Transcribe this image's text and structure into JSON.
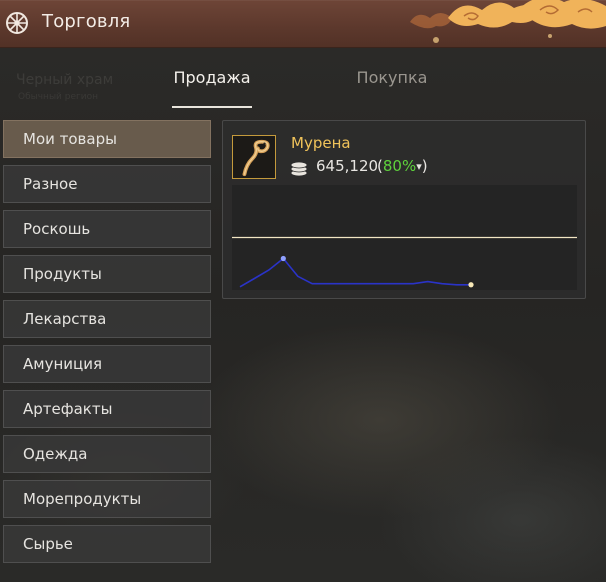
{
  "window": {
    "title": "Торговля",
    "icon": "wheel-icon"
  },
  "background": {
    "location_name": "Черный храм",
    "location_sub": "Обычный регион"
  },
  "tabs": [
    {
      "label": "Продажа",
      "active": true
    },
    {
      "label": "Покупка",
      "active": false
    }
  ],
  "categories": [
    {
      "label": "Мои товары",
      "active": true
    },
    {
      "label": "Разное",
      "active": false
    },
    {
      "label": "Роскошь",
      "active": false
    },
    {
      "label": "Продукты",
      "active": false
    },
    {
      "label": "Лекарства",
      "active": false
    },
    {
      "label": "Амуниция",
      "active": false
    },
    {
      "label": "Артефакты",
      "active": false
    },
    {
      "label": "Одежда",
      "active": false
    },
    {
      "label": "Морепродукты",
      "active": false
    },
    {
      "label": "Сырье",
      "active": false
    }
  ],
  "item": {
    "name": "Мурена",
    "icon": "moray-eel-icon",
    "price": "645,120",
    "percent_open": "(",
    "percent": "80%",
    "percent_arrow": "▾",
    "percent_close": ")",
    "colors": {
      "name": "#f0c35a",
      "percent": "#5ed23c",
      "graph_line": "#2a33c8",
      "reference_line": "#f2e6c4"
    }
  },
  "chart_data": {
    "type": "line",
    "series": [
      {
        "values": [
          0.03,
          0.11,
          0.19,
          0.3,
          0.13,
          0.06,
          0.06,
          0.06,
          0.06,
          0.06,
          0.06,
          0.06,
          0.06,
          0.08,
          0.06,
          0.05,
          0.05
        ]
      }
    ],
    "reference_line": 0.5,
    "ylim": [
      0,
      1
    ]
  }
}
